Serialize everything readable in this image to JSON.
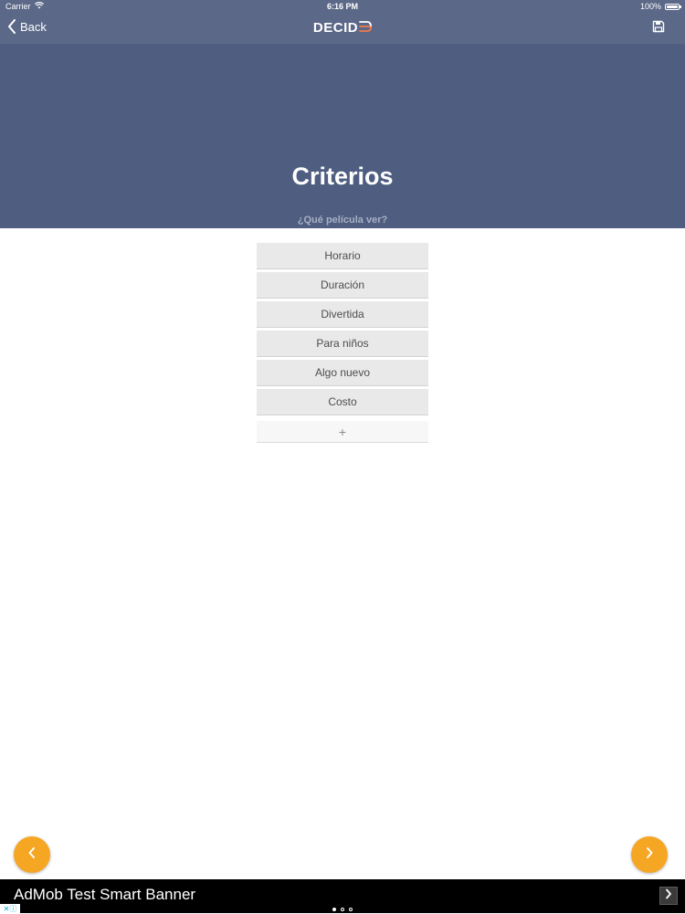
{
  "status_bar": {
    "carrier": "Carrier",
    "time": "6:16 PM",
    "battery": "100%",
    "battery_level": 1.0
  },
  "nav": {
    "back_label": "Back",
    "logo_text": "DECID",
    "back_icon": "chevron-left-icon",
    "save_icon": "floppy-disk-icon"
  },
  "header": {
    "title": "Criterios",
    "subtitle": "¿Qué película ver?"
  },
  "criteria": [
    {
      "label": "Horario"
    },
    {
      "label": "Duración"
    },
    {
      "label": "Divertida"
    },
    {
      "label": "Para niños"
    },
    {
      "label": "Algo nuevo"
    },
    {
      "label": "Costo"
    }
  ],
  "add_button": {
    "label": "+"
  },
  "ad": {
    "text": "AdMob Test Smart Banner",
    "choices_label": "✕ⓘ"
  },
  "pagination": {
    "total": 3,
    "current": 1
  },
  "colors": {
    "nav_bg": "#5b6887",
    "header_bg": "#4f5d80",
    "accent": "#f5a623",
    "logo_accent": "#f07b4d"
  }
}
